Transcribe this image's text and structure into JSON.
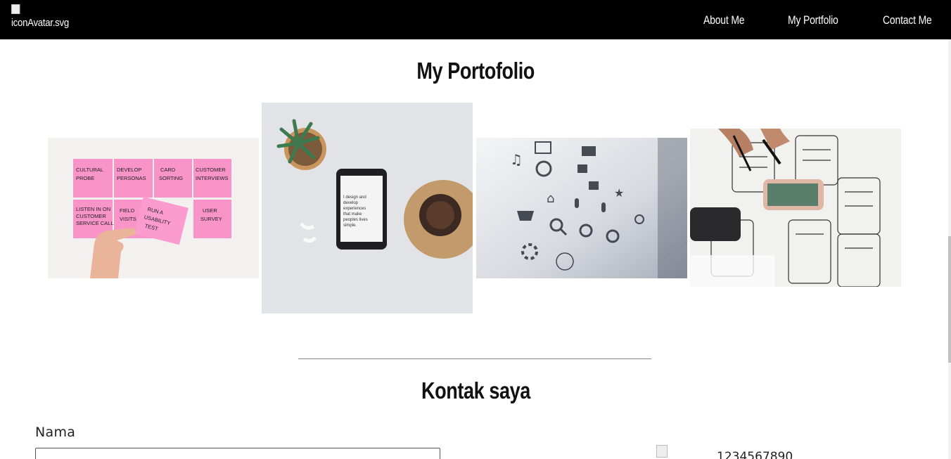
{
  "navbar": {
    "logo_alt": "iconAvatar.svg",
    "links": [
      {
        "label": "About Me"
      },
      {
        "label": "My Portfolio"
      },
      {
        "label": "Contact Me"
      }
    ]
  },
  "portfolio": {
    "title": "My Portofolio",
    "images": [
      {
        "name": "sticky-notes-ux-research",
        "notes": [
          "CULTURAL PROBE",
          "DEVELOP PERSONAS",
          "CARD SORTING",
          "CUSTOMER INTERVIEWS",
          "LISTEN IN ON CUSTOMER SERVICE CALLS",
          "FIELD VISITS",
          "RUN A USABILITY TEST",
          "USER SURVEY"
        ]
      },
      {
        "name": "phone-plant-desk",
        "phone_text": "I design and develop experiences that make peoples lives simple."
      },
      {
        "name": "ui-icons-grid"
      },
      {
        "name": "wireframe-sketching"
      }
    ]
  },
  "contact": {
    "title": "Kontak saya",
    "name_label": "Nama",
    "name_value": "",
    "phone": "1234567890"
  },
  "colors": {
    "navbar_bg": "#000000",
    "sticky_note": "#f88fc8",
    "page_bg": "#ffffff"
  }
}
